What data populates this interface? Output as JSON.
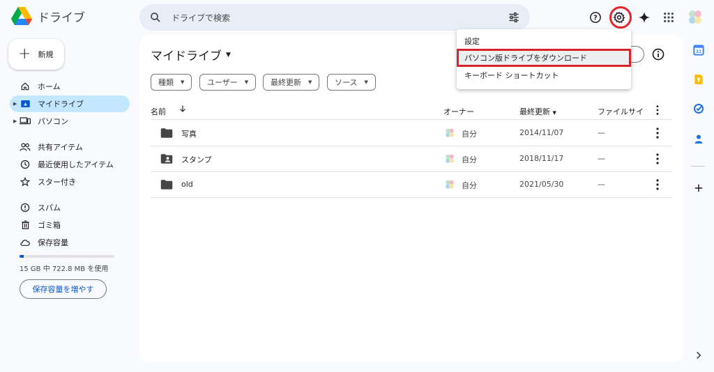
{
  "app": {
    "name": "ドライブ",
    "search_placeholder": "ドライブで検索"
  },
  "sidebar": {
    "new_label": "新規",
    "items": [
      {
        "label": "ホーム",
        "icon": "home-icon"
      },
      {
        "label": "マイドライブ",
        "icon": "my-drive-icon"
      },
      {
        "label": "パソコン",
        "icon": "computer-icon"
      },
      {
        "label": "共有アイテム",
        "icon": "shared-icon"
      },
      {
        "label": "最近使用したアイテム",
        "icon": "clock-icon"
      },
      {
        "label": "スター付き",
        "icon": "star-icon"
      },
      {
        "label": "スパム",
        "icon": "spam-icon"
      },
      {
        "label": "ゴミ箱",
        "icon": "trash-icon"
      },
      {
        "label": "保存容量",
        "icon": "cloud-icon"
      }
    ],
    "storage_fraction": 0.047,
    "storage_text": "15 GB 中 722.8 MB を使用",
    "get_more_storage": "保存容量を増やす"
  },
  "main": {
    "title": "マイドライブ",
    "filters": [
      "種類",
      "ユーザー",
      "最終更新",
      "ソース"
    ],
    "columns": {
      "name": "名前",
      "owner": "オーナー",
      "modified": "最終更新",
      "size": "ファイルサイ"
    },
    "rows": [
      {
        "name": "写真",
        "owner": "自分",
        "date": "2014/11/07",
        "size": "—",
        "icon": "folder-icon"
      },
      {
        "name": "スタンプ",
        "owner": "自分",
        "date": "2018/11/17",
        "size": "—",
        "icon": "shared-folder-icon"
      },
      {
        "name": "old",
        "owner": "自分",
        "date": "2021/05/30",
        "size": "—",
        "icon": "folder-icon"
      }
    ]
  },
  "settings_menu": {
    "items": [
      "設定",
      "パソコン版ドライブをダウンロード",
      "キーボード ショートカット"
    ],
    "highlighted_index": 1
  },
  "colors": {
    "accent_blue": "#0b57d0",
    "active_nav": "#c2e7ff",
    "highlight_red": "#e8232a"
  }
}
